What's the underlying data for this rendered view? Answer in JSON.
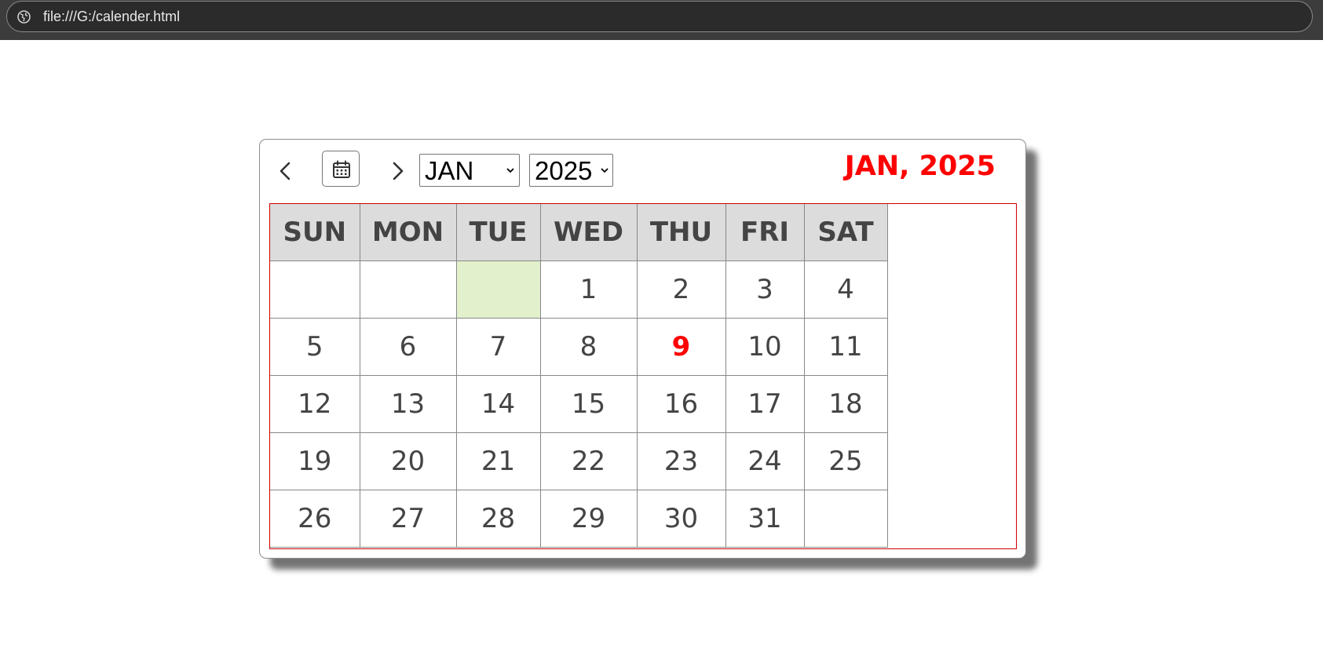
{
  "browser": {
    "url": "file:///G:/calender.html"
  },
  "calendar": {
    "heading": "JAN, 2025",
    "month_select": "JAN",
    "year_select": "2025",
    "weekdays": [
      "SUN",
      "MON",
      "TUE",
      "WED",
      "THU",
      "FRI",
      "SAT"
    ],
    "today": "9",
    "weeks": [
      [
        "",
        "",
        "",
        "1",
        "2",
        "3",
        "4"
      ],
      [
        "5",
        "6",
        "7",
        "8",
        "9",
        "10",
        "11"
      ],
      [
        "12",
        "13",
        "14",
        "15",
        "16",
        "17",
        "18"
      ],
      [
        "19",
        "20",
        "21",
        "22",
        "23",
        "24",
        "25"
      ],
      [
        "26",
        "27",
        "28",
        "29",
        "30",
        "31",
        ""
      ]
    ],
    "colors": {
      "accent": "#ff0000",
      "header_bg": "#dcdcdc",
      "highlight_cell": "#e2f0cb",
      "frame": "#cc0000"
    },
    "icons": {
      "prev": "chevron-left-icon",
      "next": "chevron-right-icon",
      "today": "calendar-icon",
      "dropdown": "chevron-down-icon",
      "site": "globe-icon"
    }
  }
}
